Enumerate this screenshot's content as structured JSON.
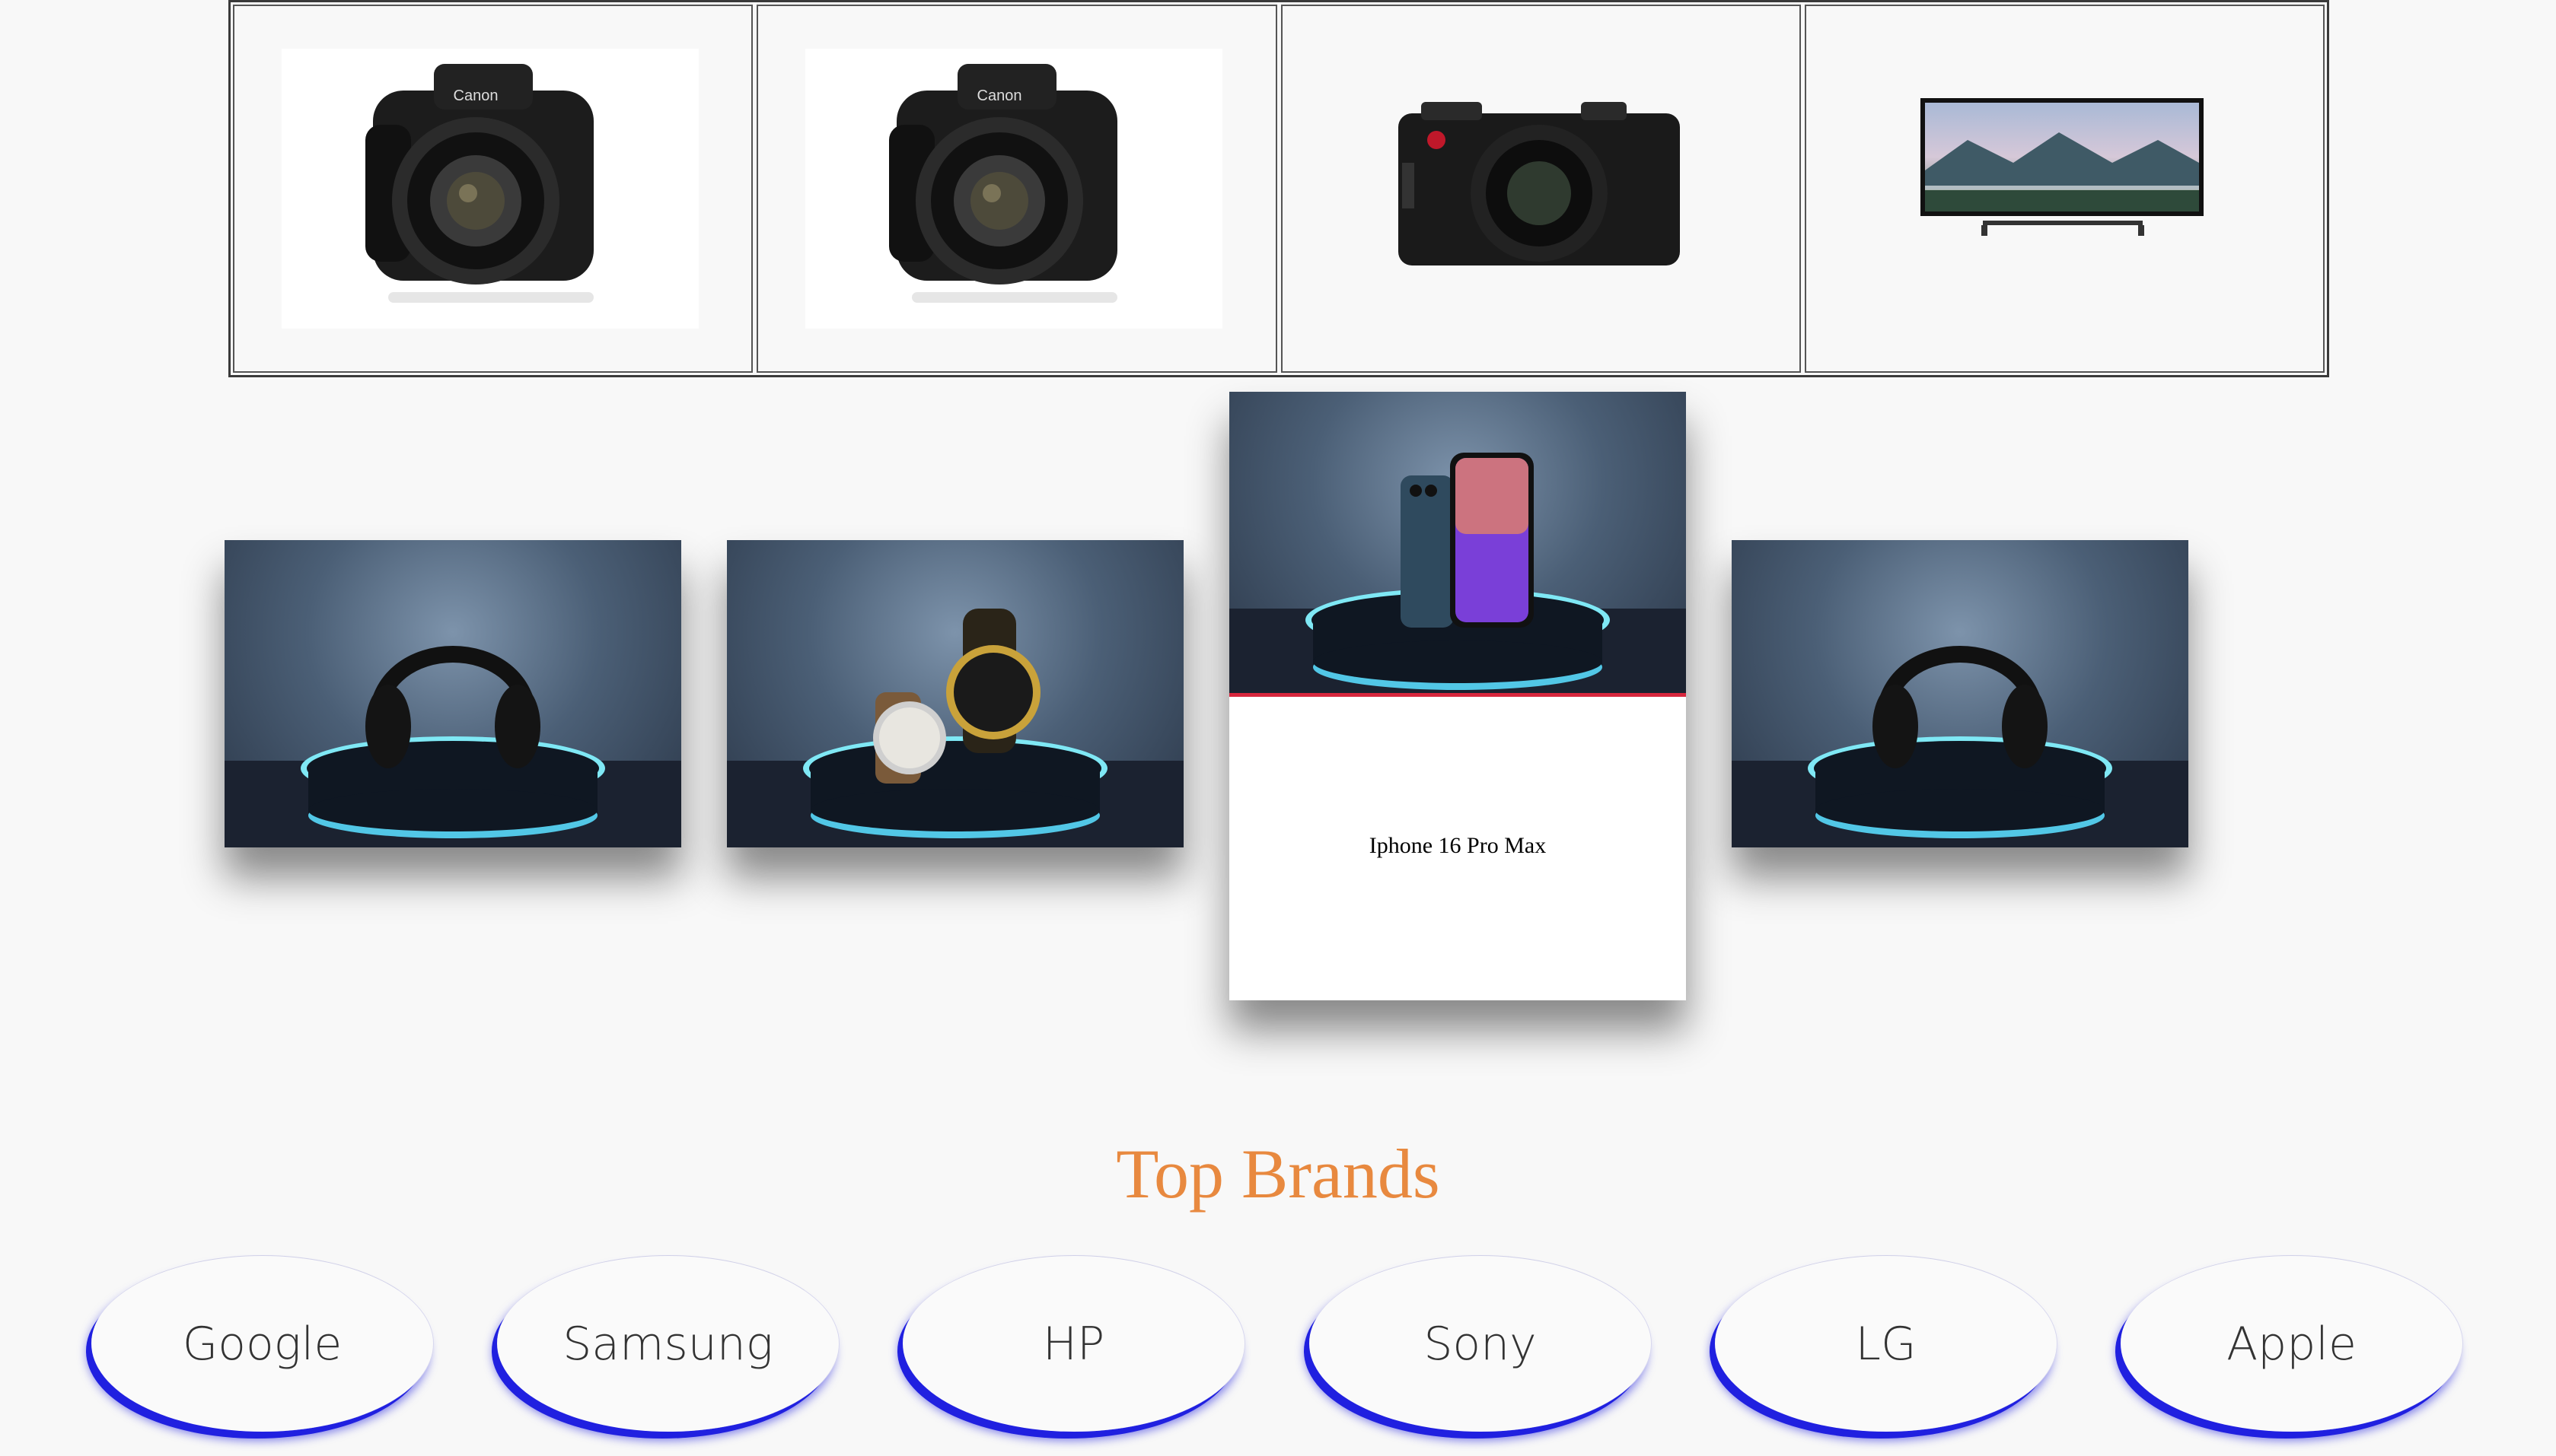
{
  "product_grid": {
    "items": [
      {
        "image": "canon-dslr-camera"
      },
      {
        "image": "canon-dslr-camera"
      },
      {
        "image": "leica-compact-camera"
      },
      {
        "image": "flat-screen-tv"
      }
    ]
  },
  "carousel": {
    "slides": [
      {
        "image": "headphones-on-pedestal"
      },
      {
        "image": "watches-on-pedestal"
      },
      {
        "image": "iphone-on-pedestal",
        "caption": "Iphone 16 Pro Max",
        "active": true
      },
      {
        "image": "headphones-on-pedestal"
      }
    ],
    "active_accent": "#d7263d"
  },
  "brands": {
    "title": "Top Brands",
    "title_color": "#e8893f",
    "items": [
      "Google",
      "Samsung",
      "HP",
      "Sony",
      "LG",
      "Apple"
    ],
    "accent": "#2020e0"
  }
}
